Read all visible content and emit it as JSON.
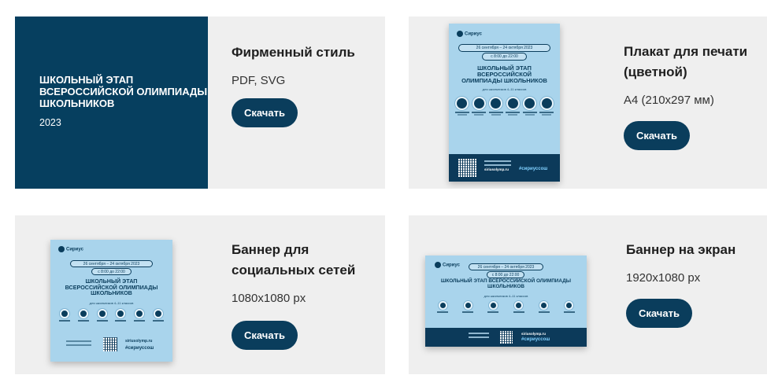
{
  "cards": [
    {
      "title": "Фирменный стиль",
      "subtitle": "PDF, SVG",
      "button": "Скачать",
      "thumb": {
        "title": "ШКОЛЬНЫЙ ЭТАП ВСЕРОССИЙСКОЙ ОЛИМПИАДЫ ШКОЛЬНИКОВ",
        "year": "2023"
      }
    },
    {
      "title": "Плакат для печати (цветной)",
      "subtitle": "А4 (210х297 мм)",
      "button": "Скачать"
    },
    {
      "title": "Баннер для социальных сетей",
      "subtitle": "1080х1080 px",
      "button": "Скачать"
    },
    {
      "title": "Баннер на экран",
      "subtitle": "1920х1080 px",
      "button": "Скачать"
    }
  ],
  "poster": {
    "logo": "Сириус",
    "dates": "26 сентября – 24 октября 2023",
    "time": "с 8:00 до 22:00",
    "headline": "ШКОЛЬНЫЙ ЭТАП ВСЕРОССИЙСКОЙ ОЛИМПИАДЫ ШКОЛЬНИКОВ",
    "audience": "для школьников 4–11 классов",
    "site": "siriusolymp.ru",
    "hashtag": "#сириуссош"
  },
  "colors": {
    "brand_dark": "#063f5f",
    "button": "#0a3d5c",
    "poster_bg": "#a9d4ec",
    "card_bg": "#efefef"
  }
}
